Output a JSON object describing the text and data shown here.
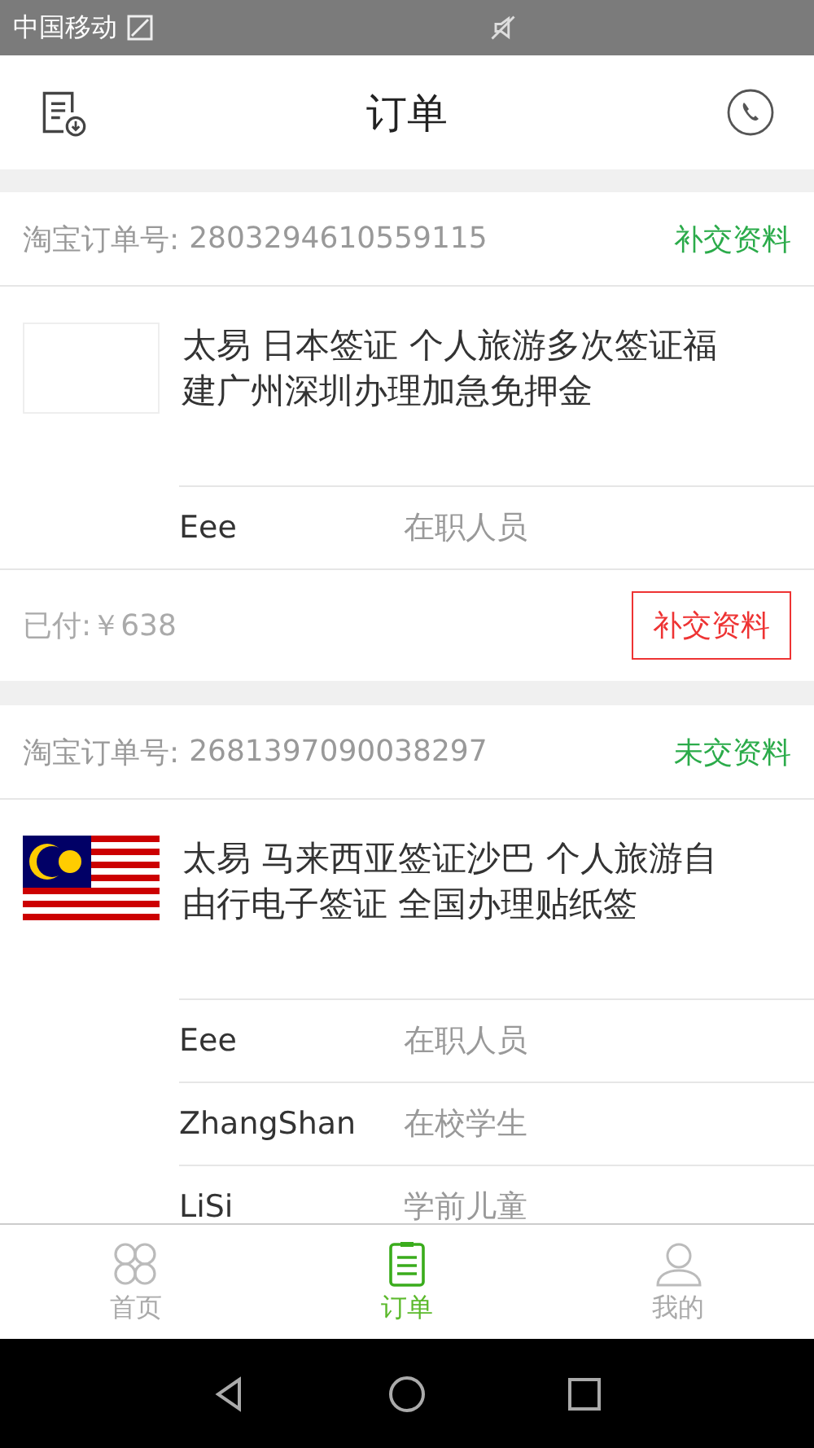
{
  "status_bar": {
    "carrier": "中国移动"
  },
  "header": {
    "title": "订单"
  },
  "orders": [
    {
      "order_label": "淘宝订单号:",
      "order_number": "2803294610559115",
      "status": "补交资料",
      "image": {
        "kind": "blank"
      },
      "title": "太易 日本签证 个人旅游多次签证福建广州深圳办理加急免押金",
      "travelers": [
        {
          "name": "Eee",
          "type": "在职人员"
        }
      ],
      "paid": "已付:￥638",
      "action_button": "补交资料"
    },
    {
      "order_label": "淘宝订单号:",
      "order_number": "2681397090038297",
      "status": "未交资料",
      "image": {
        "kind": "flag"
      },
      "title": "太易 马来西亚签证沙巴 个人旅游自由行电子签证 全国办理贴纸签",
      "travelers": [
        {
          "name": "Eee",
          "type": "在职人员"
        },
        {
          "name": "ZhangShan",
          "type": "在校学生"
        },
        {
          "name": "LiSi",
          "type": "学前儿童"
        }
      ]
    }
  ],
  "tab_bar": [
    {
      "label": "首页",
      "kind": "home",
      "selected": false
    },
    {
      "label": "订单",
      "kind": "orders",
      "selected": true
    },
    {
      "label": "我的",
      "kind": "profile",
      "selected": false
    }
  ]
}
